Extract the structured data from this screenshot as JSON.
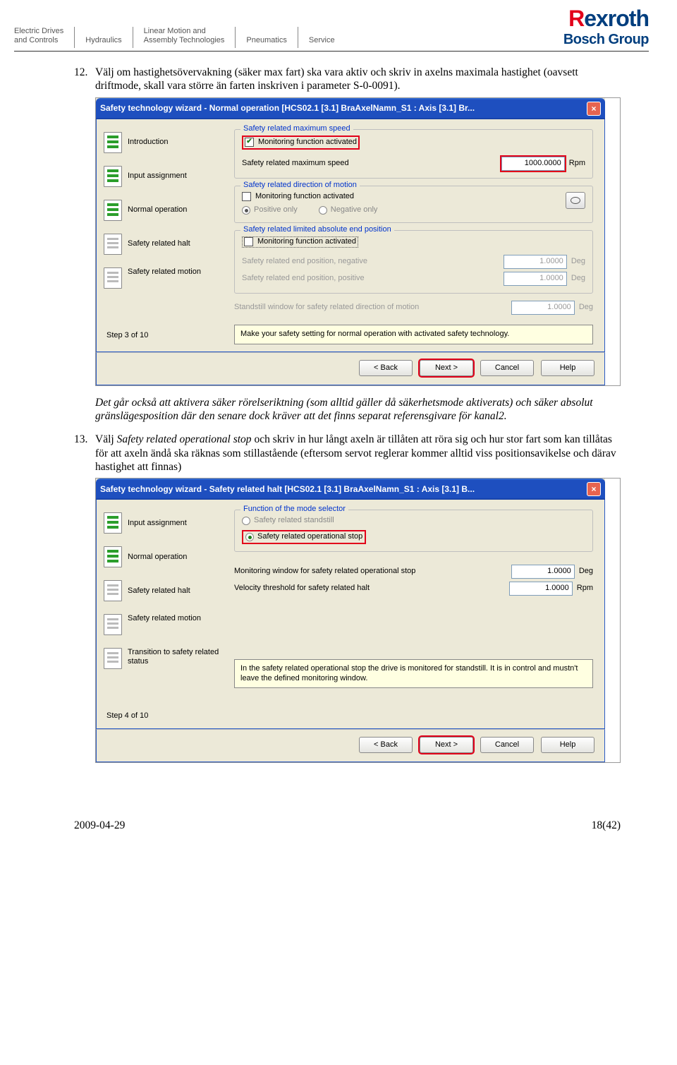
{
  "header": {
    "items": [
      "Electric Drives\nand Controls",
      "Hydraulics",
      "Linear Motion and\nAssembly Technologies",
      "Pneumatics",
      "Service"
    ],
    "logo_main_r": "R",
    "logo_main_rest": "exroth",
    "logo_sub": "Bosch Group"
  },
  "para12_num": "12.",
  "para12": "Välj om hastighetsövervakning (säker max fart) ska vara aktiv och skriv in axelns maximala hastighet (oavsett driftmode, skall vara större än farten inskriven i parameter S-0-0091).",
  "para12b": "Det går också att aktivera säker rörelseriktning (som alltid gäller då säkerhetsmode aktiverats) och säker absolut gränslägesposition där den senare dock kräver att det finns separat referensgivare för kanal2.",
  "para13_num": "13.",
  "para13_a": "Välj ",
  "para13_i": "Safety related operational stop",
  "para13_b": " och skriv in hur långt axeln är tillåten att röra sig och hur stor fart som kan tillåtas för att axeln ändå ska räknas som stillastående (eftersom servot reglerar kommer alltid viss positionsavikelse och därav hastighet att finnas)",
  "win1": {
    "title": "Safety technology wizard - Normal operation [HCS02.1 [3.1] BraAxelNamn_S1 : Axis [3.1] Br...",
    "steps": [
      "Introduction",
      "Input assignment",
      "Normal operation",
      "Safety related halt",
      "Safety related motion"
    ],
    "step_done_count": 3,
    "step_label": "Step 3 of 10",
    "g1_title": "Safety related maximum speed",
    "g1_chk": "Monitoring function activated",
    "g1_lbl": "Safety related maximum speed",
    "g1_val": "1000.0000",
    "g1_unit": "Rpm",
    "g2_title": "Safety related direction of motion",
    "g2_chk": "Monitoring function activated",
    "g2_r1": "Positive only",
    "g2_r2": "Negative only",
    "g3_title": "Safety related limited absolute end position",
    "g3_chk": "Monitoring function activated",
    "g3_l1": "Safety related end position, negative",
    "g3_l2": "Safety related end position, positive",
    "g3_v": "1.0000",
    "g3_u": "Deg",
    "standstill_lbl": "Standstill window for safety related direction of motion",
    "standstill_v": "1.0000",
    "standstill_u": "Deg",
    "hint": "Make your safety setting for normal operation with activated safety technology.",
    "btns": [
      "< Back",
      "Next >",
      "Cancel",
      "Help"
    ]
  },
  "win2": {
    "title": "Safety technology wizard - Safety related halt [HCS02.1 [3.1] BraAxelNamn_S1 : Axis [3.1] B...",
    "steps": [
      "Input assignment",
      "Normal operation",
      "Safety related halt",
      "Safety related motion",
      "Transition to safety related status"
    ],
    "step_done_count": 2,
    "step_label": "Step 4 of 10",
    "g1_title": "Function of the mode selector",
    "g1_r1": "Safety related standstill",
    "g1_r2": "Safety related operational stop",
    "l1": "Monitoring window for safety related operational stop",
    "l2": "Velocity threshold for safety related halt",
    "v": "1.0000",
    "u1": "Deg",
    "u2": "Rpm",
    "hint": "In the safety related operational stop the drive is monitored for standstill. It is in control and mustn't leave the defined monitoring window.",
    "btns": [
      "< Back",
      "Next >",
      "Cancel",
      "Help"
    ]
  },
  "footer_date": "2009-04-29",
  "footer_page": "18(42)"
}
